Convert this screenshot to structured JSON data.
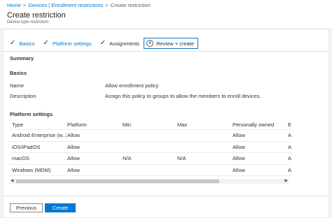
{
  "breadcrumb": {
    "items": [
      "Home",
      "Devices | Enrollment restrictions",
      "Create restriction"
    ],
    "separator": ">"
  },
  "header": {
    "title": "Create restriction",
    "subtitle": "Device type restriction"
  },
  "tabs": [
    {
      "label": "Basics",
      "state": "completed"
    },
    {
      "label": "Platform settings",
      "state": "completed"
    },
    {
      "label": "Assignments",
      "state": "completed"
    },
    {
      "label": "Review + create",
      "state": "active",
      "number": "4"
    }
  ],
  "summary": {
    "heading": "Summary",
    "basics_heading": "Basics",
    "fields": [
      {
        "key": "Name",
        "value": "Allow enrollment policy"
      },
      {
        "key": "Description",
        "value": "Assign this policy to groups to allow the members to enroll devices."
      }
    ]
  },
  "platform_settings": {
    "heading": "Platform settings",
    "columns": [
      "Type",
      "Platform",
      "Min",
      "Max",
      "Personally owned",
      "E"
    ],
    "rows": [
      [
        "Android Enterprise (w...",
        "Allow",
        "",
        "",
        "Allow",
        "A"
      ],
      [
        "iOS/iPadOS",
        "Allow",
        "",
        "",
        "Allow",
        "A"
      ],
      [
        "macOS",
        "Allow",
        "N/A",
        "N/A",
        "Allow",
        "A"
      ],
      [
        "Windows (MDM)",
        "Allow",
        "",
        "",
        "Allow",
        "A"
      ]
    ]
  },
  "footer": {
    "previous_label": "Previous",
    "create_label": "Create"
  },
  "colors": {
    "accent": "#0078d4",
    "text": "#323130",
    "border": "#edebe9"
  }
}
